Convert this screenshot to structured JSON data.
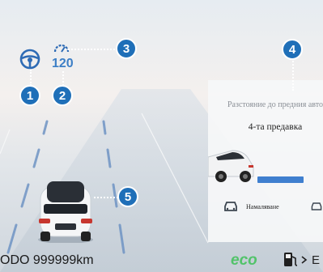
{
  "cluster": {
    "speed_limit": "120",
    "distance_label": "Разстояние до предния автомобил",
    "gear_status": "4-та предавка",
    "reduce_label": "Намаляване",
    "odometer": "ODO 999999km",
    "eco_mode": "eco",
    "fuel_level_label": "E"
  },
  "callouts": [
    "1",
    "2",
    "3",
    "4",
    "5"
  ],
  "icons": {
    "steering": "steering-wheel-icon",
    "speedometer": "speedometer-icon",
    "fuel": "fuel-pump-icon",
    "car_small": "car-outline-icon"
  },
  "colors": {
    "accent": "#1f6fb8",
    "speed_text": "#3d7fc6",
    "eco": "#52c36a",
    "progress": "#3f7fcf"
  }
}
